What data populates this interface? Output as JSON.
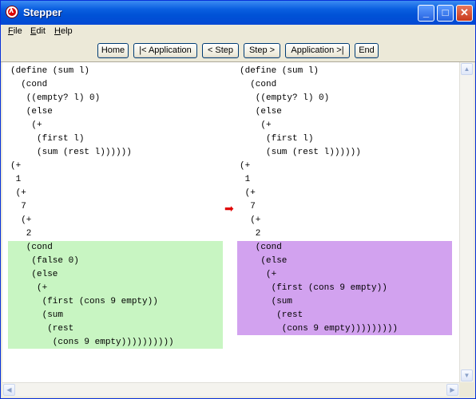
{
  "window": {
    "title": "Stepper"
  },
  "titlebar_buttons": {
    "minimize": "_",
    "maximize": "□",
    "close": "✕"
  },
  "menu": [
    {
      "label": "File",
      "mnemonic": "F",
      "rest": "ile"
    },
    {
      "label": "Edit",
      "mnemonic": "E",
      "rest": "dit"
    },
    {
      "label": "Help",
      "mnemonic": "H",
      "rest": "elp"
    }
  ],
  "toolbar": {
    "home": "Home",
    "prev_application": "|< Application",
    "prev_step": "< Step",
    "next_step": "Step >",
    "next_application": "Application >|",
    "end": "End"
  },
  "colors": {
    "before_highlight": "#c8f5c2",
    "after_highlight": "#d2a2ef",
    "step_arrow": "#e00000"
  },
  "left_pane": {
    "context": "(define (sum l)\n  (cond\n   ((empty? l) 0)\n   (else\n    (+\n     (first l)\n     (sum (rest l))))))\n(+\n 1\n (+\n  7\n  (+\n   2",
    "redex": "   (cond\n    (false 0)\n    (else\n     (+\n      (first (cons 9 empty))\n      (sum\n       (rest\n        (cons 9 empty)",
    "redex_tail": ")))))))))"
  },
  "right_pane": {
    "context": "(define (sum l)\n  (cond\n   ((empty? l) 0)\n   (else\n    (+\n     (first l)\n     (sum (rest l))))))\n(+\n 1\n (+\n  7\n  (+\n   2",
    "redex": "   (cond\n    (else\n     (+\n      (first (cons 9 empty))\n      (sum\n       (rest\n        (cons 9 empty))))))",
    "redex_tail": ")))"
  },
  "step_arrow": "➡",
  "scroll_arrows": {
    "up": "▲",
    "down": "▼",
    "left": "◀",
    "right": "▶"
  }
}
